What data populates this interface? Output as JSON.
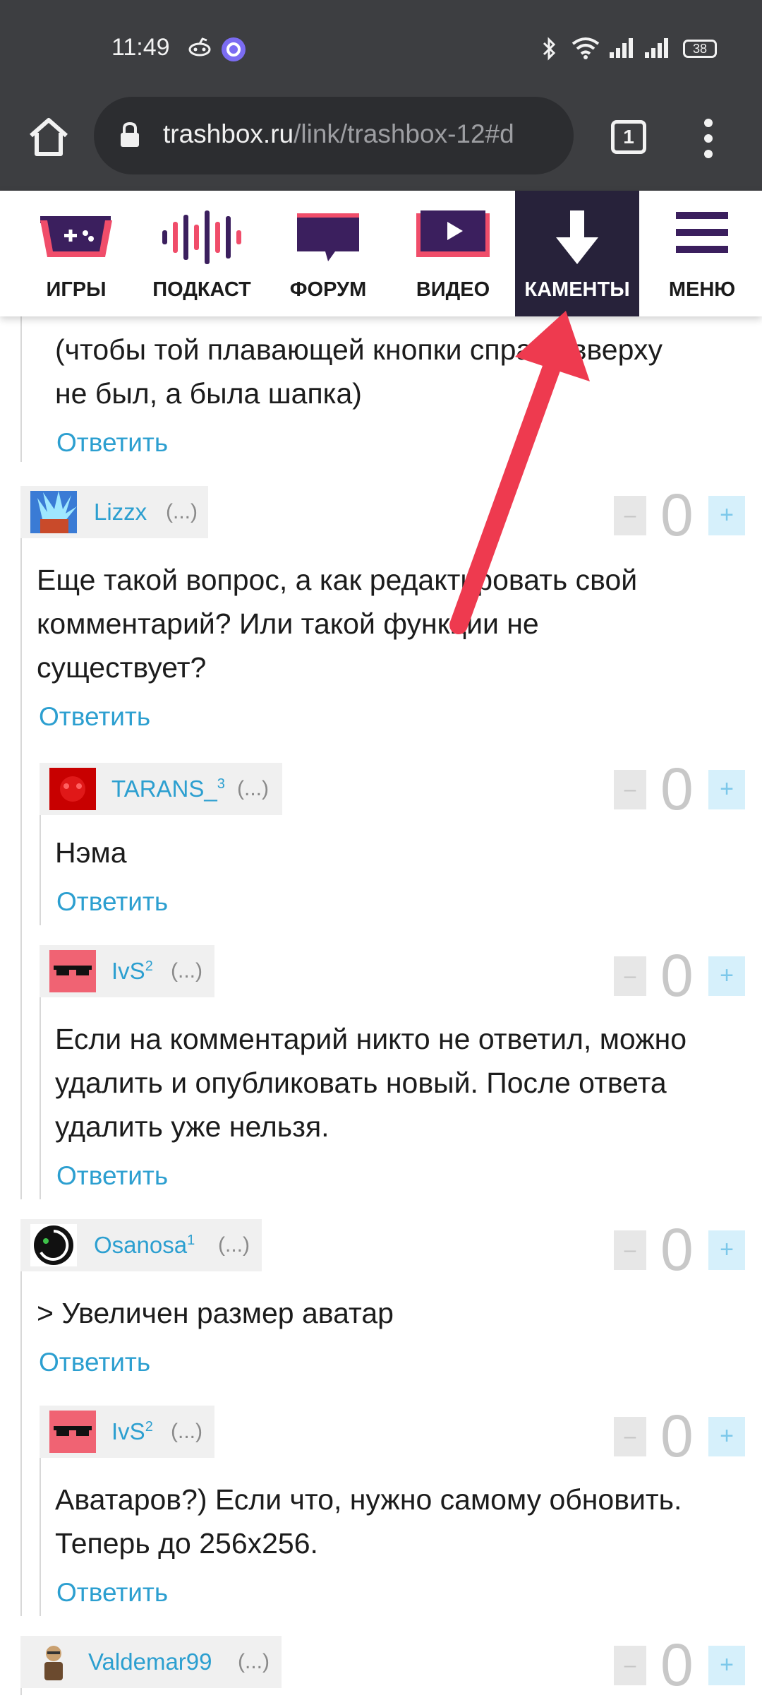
{
  "status": {
    "time": "11:49",
    "battery": "38"
  },
  "browser": {
    "url_host": "trashbox.ru",
    "url_path": "/link/trashbox-12#d",
    "tab_count": "1"
  },
  "nav": {
    "items": [
      {
        "label": "ИГРЫ",
        "icon": "gamepad-icon"
      },
      {
        "label": "ПОДКАСТ",
        "icon": "podcast-icon"
      },
      {
        "label": "ФОРУМ",
        "icon": "forum-icon"
      },
      {
        "label": "ВИДЕО",
        "icon": "video-icon"
      },
      {
        "label": "КАМЕНТЫ",
        "icon": "arrow-down-icon",
        "active": true
      },
      {
        "label": "МЕНЮ",
        "icon": "hamburger-icon"
      }
    ]
  },
  "reply_label": "Ответить",
  "partial_comment": {
    "text_line1": "(чтобы той плавающей кнопки справа вверху",
    "text_line2": "не был, а была шапка)"
  },
  "comments": [
    {
      "user": "Lizzx",
      "level": "",
      "more": "(...)",
      "score": "0",
      "lines": [
        "Еще такой вопрос, а как редактировать свой",
        "комментарий? Или такой функции не",
        "существует?"
      ]
    },
    {
      "user": "TARANS_",
      "level": "3",
      "more": "(...)",
      "score": "0",
      "lines": [
        "Нэма"
      ]
    },
    {
      "user": "IvS",
      "level": "2",
      "more": "(...)",
      "score": "0",
      "lines": [
        "Если на комментарий никто не ответил, можно",
        "удалить и опубликовать новый. После ответа",
        "удалить уже нельзя."
      ]
    },
    {
      "user": "Osanosa",
      "level": "1",
      "more": "(...)",
      "score": "0",
      "lines": [
        "> Увеличен размер аватар"
      ]
    },
    {
      "user": "IvS",
      "level": "2",
      "more": "(...)",
      "score": "0",
      "lines": [
        "Аватаров?) Если что, нужно самому обновить.",
        "Теперь до 256x256."
      ]
    },
    {
      "user": "Valdemar99",
      "level": "",
      "more": "(...)",
      "score": "0",
      "lines": []
    }
  ],
  "vote": {
    "minus": "–",
    "plus": "+"
  },
  "colors": {
    "link": "#2c9fd0",
    "nav_active": "#27223a",
    "brand_pink": "#f04d6a",
    "brand_purple": "#3b1f5e",
    "arrow": "#ee3a4f"
  }
}
